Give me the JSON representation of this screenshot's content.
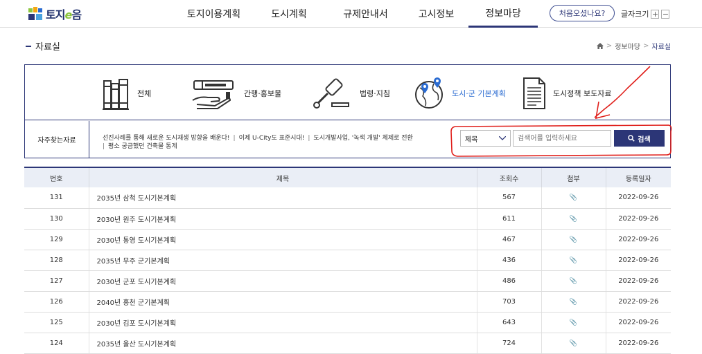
{
  "header": {
    "logo_text_a": "토지",
    "logo_text_e": "e",
    "logo_text_b": "음",
    "nav": [
      "토지이용계획",
      "도시계획",
      "규제안내서",
      "고시정보",
      "정보마당"
    ],
    "active_nav": 4,
    "first_visit_label": "처음오셨나요?",
    "font_size_label": "글자크기",
    "font_plus": "+",
    "font_minus": "−"
  },
  "page": {
    "title": "자료실",
    "breadcrumb": [
      "정보마당",
      "자료실"
    ]
  },
  "categories": [
    {
      "label": "전체",
      "icon": "books-icon",
      "active": false
    },
    {
      "label": "간행·홍보물",
      "icon": "publication-hand-icon",
      "active": false
    },
    {
      "label": "법령·지침",
      "icon": "gavel-icon",
      "active": false
    },
    {
      "label": "도시·군 기본계획",
      "icon": "globe-pin-icon",
      "active": true
    },
    {
      "label": "도시정책 보도자료",
      "icon": "document-icon",
      "active": false
    }
  ],
  "frequent": {
    "label": "자주찾는자료",
    "links": [
      "선진사례를 통해 새로운 도시재생 방향을 배운다!",
      "이제 U-City도 표준시대!",
      "도시개발사업, '녹색 개발' 체제로 전환",
      "평소 궁금했던 건축물 통계"
    ]
  },
  "search": {
    "select_value": "제목",
    "placeholder": "검색어를 입력하세요",
    "button_label": "검색"
  },
  "table": {
    "headers": [
      "번호",
      "제목",
      "조회수",
      "첨부",
      "등록일자"
    ],
    "rows": [
      {
        "no": "131",
        "title": "2035년 삼척 도시기본계획",
        "views": "567",
        "date": "2022-09-26"
      },
      {
        "no": "130",
        "title": "2030년 원주 도시기본계획",
        "views": "611",
        "date": "2022-09-26"
      },
      {
        "no": "129",
        "title": "2030년 통영 도시기본계획",
        "views": "467",
        "date": "2022-09-26"
      },
      {
        "no": "128",
        "title": "2035년 무주 군기본계획",
        "views": "436",
        "date": "2022-09-26"
      },
      {
        "no": "127",
        "title": "2030년 군포 도시기본계획",
        "views": "486",
        "date": "2022-09-26"
      },
      {
        "no": "126",
        "title": "2040년 홍천 군기본계획",
        "views": "703",
        "date": "2022-09-26"
      },
      {
        "no": "125",
        "title": "2030년 김포 도시기본계획",
        "views": "643",
        "date": "2022-09-26"
      },
      {
        "no": "124",
        "title": "2035년 울산 도시기본계획",
        "views": "724",
        "date": "2022-09-26"
      }
    ]
  },
  "colors": {
    "accent": "#2c3677",
    "active_link": "#2a6bd1",
    "annotation": "#e0201c"
  }
}
